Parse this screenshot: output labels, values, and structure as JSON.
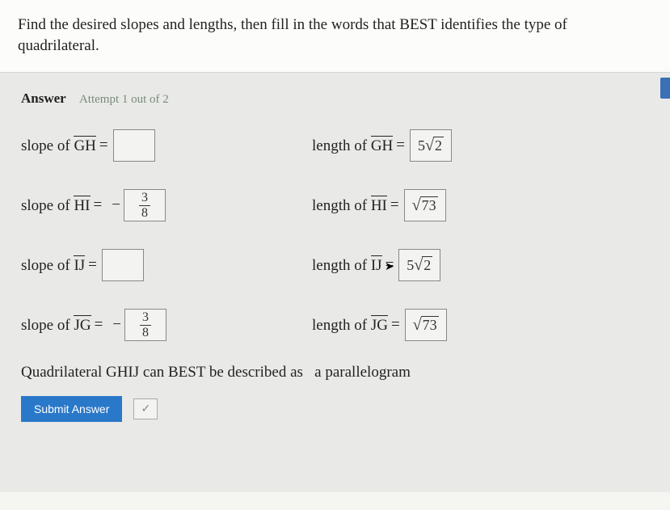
{
  "question": "Find the desired slopes and lengths, then fill in the words that BEST identifies the type of quadrilateral.",
  "answer_header": {
    "label": "Answer",
    "attempt": "Attempt 1 out of 2"
  },
  "segments": {
    "GH": "GH",
    "HI": "HI",
    "IJ": "IJ",
    "JG": "JG"
  },
  "slope_word": "slope of ",
  "length_word": "length of ",
  "eq": "=",
  "minus": "−",
  "slopes": {
    "GH": "",
    "HI": {
      "num": "3",
      "den": "8"
    },
    "IJ": "",
    "JG": {
      "num": "3",
      "den": "8"
    }
  },
  "lengths": {
    "GH": {
      "coef": "5",
      "radicand": "2"
    },
    "HI": {
      "coef": "",
      "radicand": "73"
    },
    "IJ": {
      "coef": "5",
      "radicand": "2"
    },
    "JG": {
      "coef": "",
      "radicand": "73"
    }
  },
  "conclusion": {
    "prefix": "Quadrilateral GHIJ can BEST be described as",
    "answer": "a parallelogram"
  },
  "submit": "Submit Answer"
}
